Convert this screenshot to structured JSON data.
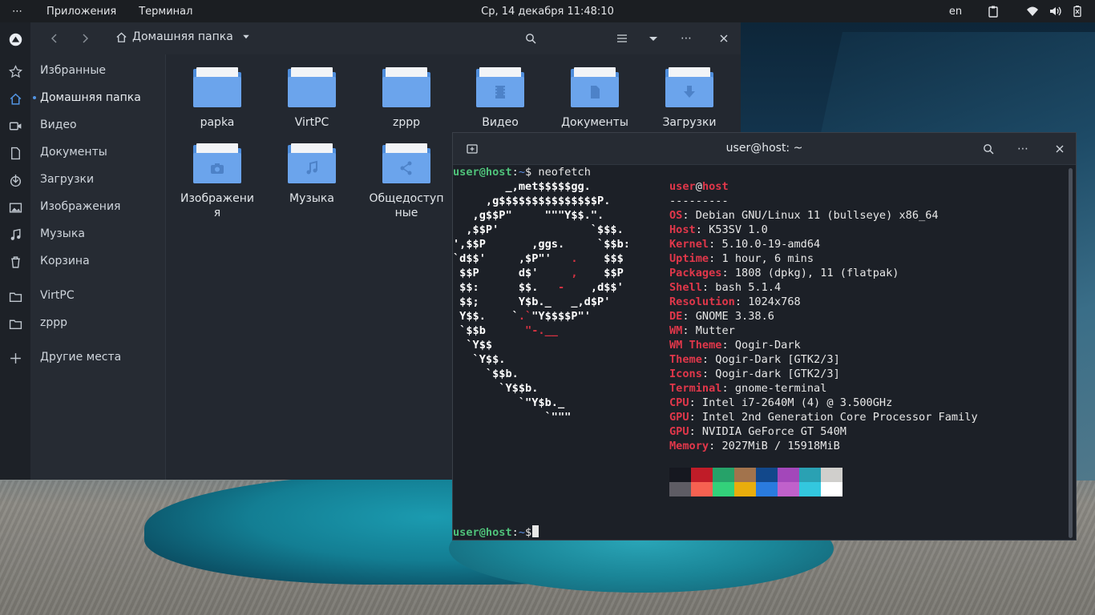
{
  "topbar": {
    "apps_label": "Приложения",
    "terminal_label": "Терминал",
    "clock": "Ср, 14 декабря  11:48:10",
    "lang": "en"
  },
  "files": {
    "location": "Домашняя папка",
    "sidebar": [
      {
        "label": "Избранные",
        "icon": "star-icon"
      },
      {
        "label": "Домашняя папка",
        "icon": "home-icon",
        "active": true
      },
      {
        "label": "Видео",
        "icon": "video-icon"
      },
      {
        "label": "Документы",
        "icon": "document-icon"
      },
      {
        "label": "Загрузки",
        "icon": "download-icon"
      },
      {
        "label": "Изображения",
        "icon": "image-icon"
      },
      {
        "label": "Музыка",
        "icon": "music-icon"
      },
      {
        "label": "Корзина",
        "icon": "trash-icon"
      },
      {
        "label": "VirtPC",
        "icon": "folder-icon"
      },
      {
        "label": "zppp",
        "icon": "folder-icon"
      },
      {
        "label": "Другие места",
        "icon": "plus-icon"
      }
    ],
    "folders": [
      {
        "label": "papka",
        "emblem": ""
      },
      {
        "label": "VirtPC",
        "emblem": ""
      },
      {
        "label": "zppp",
        "emblem": ""
      },
      {
        "label": "Видео",
        "emblem": "film-icon"
      },
      {
        "label": "Документы",
        "emblem": "document-icon"
      },
      {
        "label": "Загрузки",
        "emblem": "download-arrow-icon"
      },
      {
        "label": "Изображения",
        "emblem": "camera-icon"
      },
      {
        "label": "Музыка",
        "emblem": "music-note-icon"
      },
      {
        "label": "Общедоступные",
        "emblem": "share-icon"
      }
    ]
  },
  "terminal": {
    "title": "user@host: ~",
    "prompt_user": "user@host",
    "prompt_sep": ":",
    "prompt_path": "~",
    "prompt_char": "$",
    "command": " neofetch",
    "logo": [
      "        _,met$$$$$gg.",
      "     ,g$$$$$$$$$$$$$$$P.",
      "   ,g$$P\"     \"\"\"Y$$.\".",
      "  ,$$P'              `$$$.",
      "',$$P       ,ggs.     `$$b:",
      "`d$$'     ,$P\"'   .    $$$",
      " $$P      d$'     ,    $$P",
      " $$:      $$.   -    ,d$$'",
      " $$;      Y$b._   _,d$P'",
      " Y$$.    `.`\"Y$$$$P\"'",
      " `$$b      \"-.__",
      "  `Y$$",
      "   `Y$$.",
      "     `$$b.",
      "       `Y$$b.",
      "          `\"Y$b._",
      "              `\"\"\""
    ],
    "header_user": "user",
    "header_at": "@",
    "header_host": "host",
    "separator": "---------",
    "info": [
      {
        "key": "OS",
        "value": "Debian GNU/Linux 11 (bullseye) x86_64"
      },
      {
        "key": "Host",
        "value": "K53SV 1.0"
      },
      {
        "key": "Kernel",
        "value": "5.10.0-19-amd64"
      },
      {
        "key": "Uptime",
        "value": "1 hour, 6 mins"
      },
      {
        "key": "Packages",
        "value": "1808 (dpkg), 11 (flatpak)"
      },
      {
        "key": "Shell",
        "value": "bash 5.1.4"
      },
      {
        "key": "Resolution",
        "value": "1024x768"
      },
      {
        "key": "DE",
        "value": "GNOME 3.38.6"
      },
      {
        "key": "WM",
        "value": "Mutter"
      },
      {
        "key": "WM Theme",
        "value": "Qogir-Dark"
      },
      {
        "key": "Theme",
        "value": "Qogir-Dark [GTK2/3]"
      },
      {
        "key": "Icons",
        "value": "Qogir-dark [GTK2/3]"
      },
      {
        "key": "Terminal",
        "value": "gnome-terminal"
      },
      {
        "key": "CPU",
        "value": "Intel i7-2640M (4) @ 3.500GHz"
      },
      {
        "key": "GPU",
        "value": "Intel 2nd Generation Core Processor Family"
      },
      {
        "key": "GPU",
        "value": "NVIDIA GeForce GT 540M"
      },
      {
        "key": "Memory",
        "value": "2027MiB / 15918MiB"
      }
    ],
    "palette_row1": [
      "#161820",
      "#c01c28",
      "#26a269",
      "#a2734c",
      "#12488b",
      "#a347ba",
      "#2aa1b3",
      "#d0cfcc"
    ],
    "palette_row2": [
      "#5e5c64",
      "#f66151",
      "#33d17a",
      "#e9ad0c",
      "#2a7bde",
      "#c061cb",
      "#33c7de",
      "#ffffff"
    ]
  }
}
